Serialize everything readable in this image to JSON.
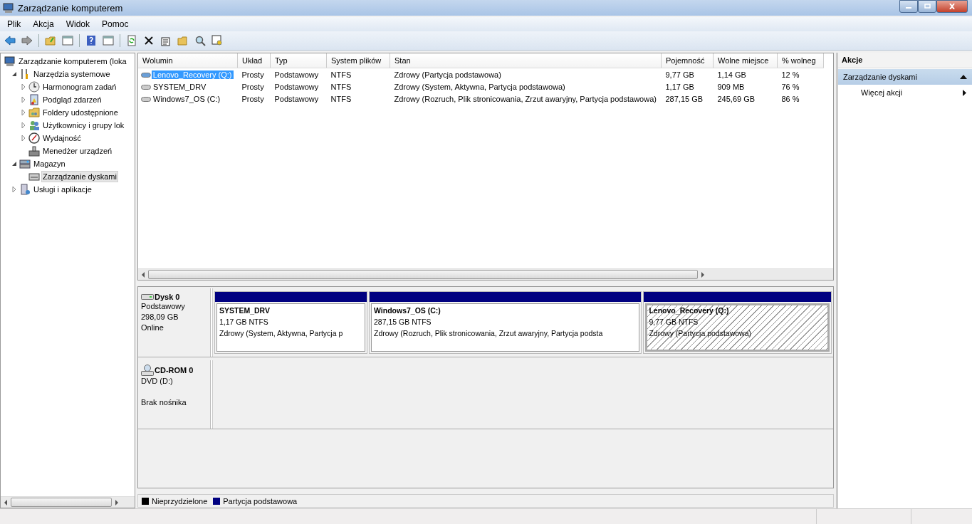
{
  "window": {
    "title": "Zarządzanie komputerem"
  },
  "menu": [
    "Plik",
    "Akcja",
    "Widok",
    "Pomoc"
  ],
  "tree": [
    {
      "label": "Zarządzanie komputerem (loka",
      "selected": false,
      "children": [
        {
          "label": "Narzędzia systemowe",
          "expanded": true,
          "selected": false,
          "children": [
            {
              "label": "Harmonogram zadań",
              "expanded": false,
              "selected": false
            },
            {
              "label": "Podgląd zdarzeń",
              "expanded": false,
              "selected": false
            },
            {
              "label": "Foldery udostępnione",
              "expanded": false,
              "selected": false
            },
            {
              "label": "Użytkownicy i grupy lok",
              "expanded": false,
              "selected": false
            },
            {
              "label": "Wydajność",
              "expanded": false,
              "selected": false
            },
            {
              "label": "Menedżer urządzeń",
              "selected": false
            }
          ]
        },
        {
          "label": "Magazyn",
          "expanded": true,
          "selected": false,
          "children": [
            {
              "label": "Zarządzanie dyskami",
              "selected": true
            }
          ]
        },
        {
          "label": "Usługi i aplikacje",
          "expanded": false,
          "selected": false
        }
      ]
    }
  ],
  "table": {
    "columns": [
      "Wolumin",
      "Układ",
      "Typ",
      "System plików",
      "Stan",
      "Pojemność",
      "Wolne miejsce",
      "% wolneg"
    ],
    "rows": [
      {
        "selected": true,
        "cells": [
          "Lenovo_Recovery (Q:)",
          "Prosty",
          "Podstawowy",
          "NTFS",
          "Zdrowy (Partycja podstawowa)",
          "9,77 GB",
          "1,14 GB",
          "12 %"
        ]
      },
      {
        "selected": false,
        "cells": [
          "SYSTEM_DRV",
          "Prosty",
          "Podstawowy",
          "NTFS",
          "Zdrowy (System, Aktywna, Partycja podstawowa)",
          "1,17 GB",
          "909 MB",
          "76 %"
        ]
      },
      {
        "selected": false,
        "cells": [
          "Windows7_OS (C:)",
          "Prosty",
          "Podstawowy",
          "NTFS",
          "Zdrowy (Rozruch, Plik stronicowania, Zrzut awaryjny, Partycja podstawowa)",
          "287,15 GB",
          "245,69 GB",
          "86 %"
        ]
      }
    ]
  },
  "disks": [
    {
      "kind": "disk",
      "name": "Dysk 0",
      "lines": [
        "Podstawowy",
        "298,09 GB",
        "Online"
      ],
      "partitions": [
        {
          "name": "SYSTEM_DRV",
          "size": "1,17 GB NTFS",
          "status": "Zdrowy (System, Aktywna, Partycja p",
          "selected": false
        },
        {
          "name": "Windows7_OS  (C:)",
          "size": "287,15 GB NTFS",
          "status": "Zdrowy (Rozruch, Plik stronicowania, Zrzut awaryjny, Partycja podsta",
          "selected": false
        },
        {
          "name": "Lenovo_Recovery  (Q:)",
          "size": "9,77 GB NTFS",
          "status": "Zdrowy (Partycja podstawowa)",
          "selected": true
        }
      ]
    },
    {
      "kind": "cdrom",
      "name": "CD-ROM 0",
      "lines": [
        "DVD (D:)",
        "Brak nośnika"
      ]
    }
  ],
  "legend": [
    {
      "label": "Nieprzydzielone",
      "color": "#000000"
    },
    {
      "label": "Partycja podstawowa",
      "color": "#000080"
    }
  ],
  "actions": {
    "title": "Akcje",
    "section": {
      "label": "Zarządzanie dyskami",
      "expanded": true
    },
    "items": [
      "Więcej akcji"
    ]
  }
}
